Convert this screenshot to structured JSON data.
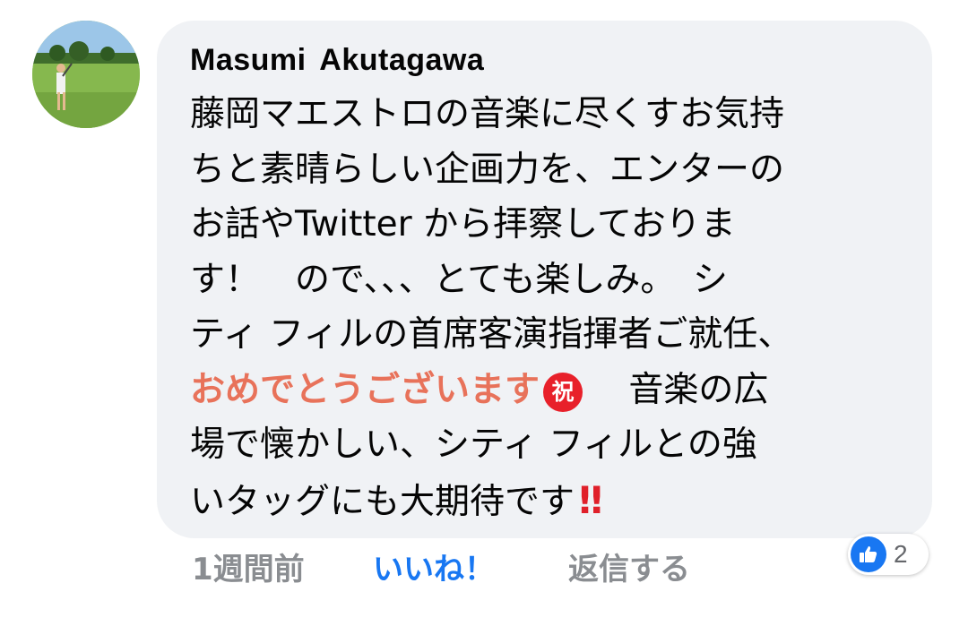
{
  "comment": {
    "author": "Masumi  Akutagawa",
    "lines": [
      "藤岡マエストロの音楽に尽くすお気持",
      "ちと素晴らしい企画力を、エンターの",
      "お話やTwitter から拝察しておりま",
      "す！　ので、、、とても楽しみ。　シ",
      "ティ フィルの首席客演指揮者ご就任、",
      "",
      "場で懐かしい、シティ フィルとの強",
      "いタッグにも大期待です"
    ],
    "congrats_text": "おめでとうございます",
    "after_congrats_text": "　 音楽の広",
    "iwai_emoji": "祝",
    "bang_emoji": "!!"
  },
  "actions": {
    "time": "1週間前",
    "like": "いいね！",
    "reply": "返信する"
  },
  "reactions": {
    "icon": "thumbs-up-icon",
    "count": "2"
  },
  "colors": {
    "bubble": "#f0f2f5",
    "like_blue": "#1877f2",
    "congrats": "#e8725a",
    "emoji_red": "#e8202a"
  }
}
